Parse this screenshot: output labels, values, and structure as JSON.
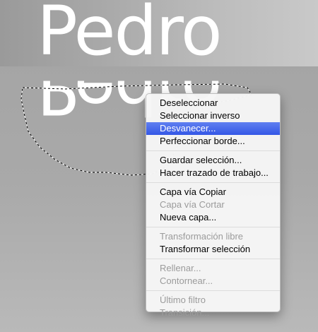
{
  "canvas": {
    "text": "Pedro",
    "reflection_text": "Pedro"
  },
  "menu": {
    "groups": [
      [
        {
          "label": "Deseleccionar",
          "enabled": true
        },
        {
          "label": "Seleccionar inverso",
          "enabled": true
        },
        {
          "label": "Desvanecer...",
          "enabled": true,
          "highlighted": true
        },
        {
          "label": "Perfeccionar borde...",
          "enabled": true
        }
      ],
      [
        {
          "label": "Guardar selección...",
          "enabled": true
        },
        {
          "label": "Hacer trazado de trabajo...",
          "enabled": true
        }
      ],
      [
        {
          "label": "Capa vía Copiar",
          "enabled": true
        },
        {
          "label": "Capa vía Cortar",
          "enabled": false
        },
        {
          "label": "Nueva capa...",
          "enabled": true
        }
      ],
      [
        {
          "label": "Transformación libre",
          "enabled": false
        },
        {
          "label": "Transformar selección",
          "enabled": true
        }
      ],
      [
        {
          "label": "Rellenar...",
          "enabled": false
        },
        {
          "label": "Contornear...",
          "enabled": false
        }
      ],
      [
        {
          "label": "Último filtro",
          "enabled": false
        },
        {
          "label": "Transición...",
          "enabled": false
        }
      ]
    ]
  },
  "colors": {
    "highlight": "#3d62ea",
    "disabled_text": "#9b9b9b"
  }
}
